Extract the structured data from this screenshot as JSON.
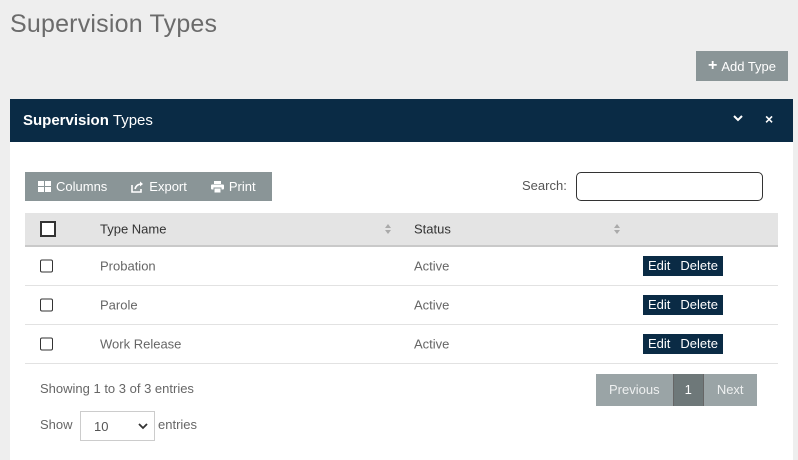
{
  "page": {
    "title": "Supervision Types"
  },
  "add_button": {
    "icon": "plus-icon",
    "label": "Add Type"
  },
  "panel": {
    "title_bold": "Supervision",
    "title_rest": "Types",
    "collapse_icon": "chevron-down-icon",
    "close_icon": "close-icon",
    "close_glyph": "×"
  },
  "toolbar": {
    "columns_label": "Columns",
    "export_label": "Export",
    "print_label": "Print"
  },
  "search": {
    "label": "Search:",
    "value": ""
  },
  "table": {
    "headers": {
      "type_name": "Type Name",
      "status": "Status"
    },
    "rows": [
      {
        "name": "Probation",
        "status": "Active",
        "edit": "Edit",
        "delete": "Delete"
      },
      {
        "name": "Parole",
        "status": "Active",
        "edit": "Edit",
        "delete": "Delete"
      },
      {
        "name": "Work Release",
        "status": "Active",
        "edit": "Edit",
        "delete": "Delete"
      }
    ]
  },
  "info": "Showing 1 to 3 of 3 entries",
  "pagination": {
    "previous": "Previous",
    "current": "1",
    "next": "Next"
  },
  "length": {
    "show": "Show",
    "value": "10",
    "entries": "entries"
  },
  "colors": {
    "header_bg": "#0a2b45",
    "button_gray": "#8a9597",
    "action_bg": "#0a2b45"
  }
}
